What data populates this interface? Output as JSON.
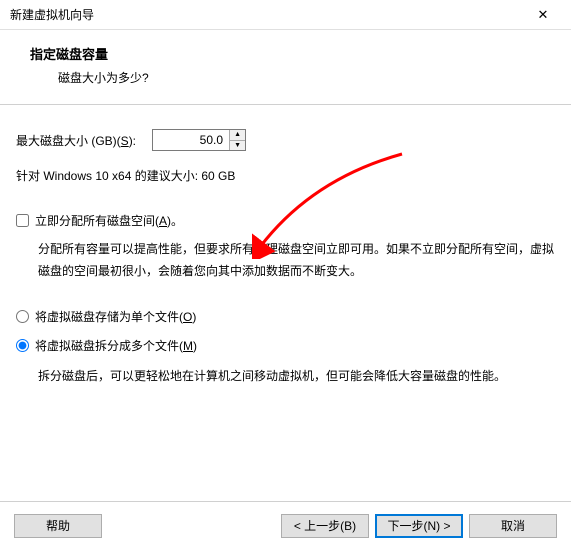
{
  "titlebar": {
    "title": "新建虚拟机向导"
  },
  "header": {
    "title": "指定磁盘容量",
    "subtitle": "磁盘大小为多少?"
  },
  "size": {
    "label_pre": "最大磁盘大小 (GB)(",
    "label_hot": "S",
    "label_post": "):",
    "value": "50.0"
  },
  "recommend": "针对 Windows 10 x64 的建议大小: 60 GB",
  "allocate": {
    "label_pre": "立即分配所有磁盘空间(",
    "label_hot": "A",
    "label_post": ")。",
    "desc": "分配所有容量可以提高性能，但要求所有物理磁盘空间立即可用。如果不立即分配所有空间，虚拟磁盘的空间最初很小，会随着您向其中添加数据而不断变大。"
  },
  "store_single": {
    "label_pre": "将虚拟磁盘存储为单个文件(",
    "label_hot": "O",
    "label_post": ")"
  },
  "store_split": {
    "label_pre": "将虚拟磁盘拆分成多个文件(",
    "label_hot": "M",
    "label_post": ")",
    "desc": "拆分磁盘后，可以更轻松地在计算机之间移动虚拟机，但可能会降低大容量磁盘的性能。"
  },
  "footer": {
    "help": "帮助",
    "back": "< 上一步(B)",
    "next": "下一步(N) >",
    "cancel": "取消"
  }
}
